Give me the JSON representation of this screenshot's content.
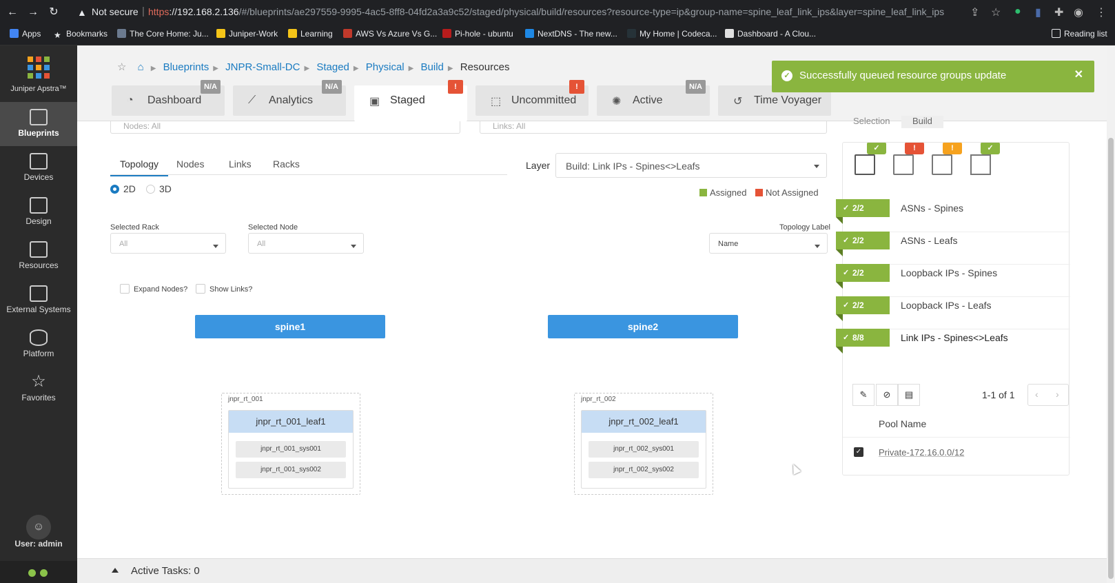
{
  "browser": {
    "not_secure": "Not secure",
    "url_scheme": "https",
    "url_host": "://192.168.2.136",
    "url_path": "/#/blueprints/ae297559-9995-4ac5-8ff8-04fd2a3a9c52/staged/physical/build/resources?resource-type=ip&group-name=spine_leaf_link_ips&layer=spine_leaf_link_ips",
    "bookmarks": [
      "Apps",
      "Bookmarks",
      "The Core Home: Ju...",
      "Juniper-Work",
      "Learning",
      "AWS Vs Azure Vs G...",
      "Pi-hole - ubuntu",
      "NextDNS - The new...",
      "My Home | Codeca...",
      "Dashboard - A Clou..."
    ],
    "reading_list": "Reading list"
  },
  "sidebar": {
    "app_name": "Juniper Apstra™",
    "items": [
      {
        "label": "Blueprints",
        "icon": "blueprints-icon"
      },
      {
        "label": "Devices",
        "icon": "devices-icon"
      },
      {
        "label": "Design",
        "icon": "design-icon"
      },
      {
        "label": "Resources",
        "icon": "resources-icon"
      },
      {
        "label": "External Systems",
        "icon": "external-systems-icon"
      },
      {
        "label": "Platform",
        "icon": "platform-icon"
      },
      {
        "label": "Favorites",
        "icon": "star-icon"
      }
    ],
    "user": "User: admin"
  },
  "breadcrumb": [
    "Blueprints",
    "JNPR-Small-DC",
    "Staged",
    "Physical",
    "Build",
    "Resources"
  ],
  "tabs": [
    {
      "label": "Dashboard",
      "badge": "N/A"
    },
    {
      "label": "Analytics",
      "badge": "N/A"
    },
    {
      "label": "Staged",
      "badge": "!"
    },
    {
      "label": "Uncommitted",
      "badge": "!"
    },
    {
      "label": "Active",
      "badge": "N/A"
    },
    {
      "label": "Time Voyager",
      "badge": ""
    }
  ],
  "toast": {
    "message": "Successfully queued resource groups update"
  },
  "filters": {
    "nodes": "Nodes: All",
    "links": "Links: All"
  },
  "subtabs": [
    "Topology",
    "Nodes",
    "Links",
    "Racks"
  ],
  "layer": {
    "label": "Layer",
    "value": "Build: Link IPs - Spines<>Leafs"
  },
  "view": {
    "d2": "2D",
    "d3": "3D"
  },
  "legend": {
    "assigned": "Assigned",
    "not_assigned": "Not Assigned",
    "assigned_color": "#8ab53f",
    "not_assigned_color": "#e55336"
  },
  "selectors": {
    "rack_label": "Selected Rack",
    "rack_value": "All",
    "node_label": "Selected Node",
    "node_value": "All",
    "topo_label": "Topology Label",
    "topo_value": "Name"
  },
  "checks": {
    "expand": "Expand Nodes?",
    "links": "Show Links?"
  },
  "topology": {
    "spines": [
      "spine1",
      "spine2"
    ],
    "racks": [
      {
        "name": "jnpr_rt_001",
        "leaf": "jnpr_rt_001_leaf1",
        "systems": [
          "jnpr_rt_001_sys001",
          "jnpr_rt_001_sys002"
        ]
      },
      {
        "name": "jnpr_rt_002",
        "leaf": "jnpr_rt_002_leaf1",
        "systems": [
          "jnpr_rt_002_sys001",
          "jnpr_rt_002_sys002"
        ]
      }
    ]
  },
  "right_panel": {
    "tabs": [
      "Selection",
      "Build"
    ],
    "resources": [
      {
        "count": "2/2",
        "name": "ASNs - Spines"
      },
      {
        "count": "2/2",
        "name": "ASNs - Leafs"
      },
      {
        "count": "2/2",
        "name": "Loopback IPs - Spines"
      },
      {
        "count": "2/2",
        "name": "Loopback IPs - Leafs"
      },
      {
        "count": "8/8",
        "name": "Link IPs - Spines<>Leafs"
      }
    ],
    "pager": "1-1 of 1",
    "pool_header": "Pool Name",
    "pool": "Private-172.16.0.0/12"
  },
  "footer": {
    "active_tasks": "Active Tasks: 0"
  }
}
